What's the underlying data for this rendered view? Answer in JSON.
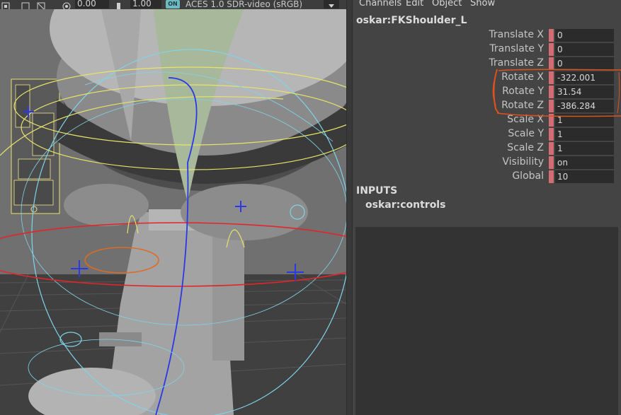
{
  "viewport_toolbar": {
    "icons": [
      "gate-mask-icon",
      "film-gate-icon",
      "resolution-gate-icon",
      "exposure-icon",
      "gamma-icon",
      "color-management-icon"
    ],
    "exposure_value": "0.00",
    "gamma_value": "1.00",
    "color_management_toggle": "ON",
    "color_space": "ACES 1.0 SDR-video (sRGB)"
  },
  "channel_box": {
    "menu": [
      "Channels",
      "Edit",
      "Object",
      "Show"
    ],
    "node_name": "oskar:FKShoulder_L",
    "attributes": [
      {
        "label": "Translate X",
        "value": "0"
      },
      {
        "label": "Translate Y",
        "value": "0"
      },
      {
        "label": "Translate Z",
        "value": "0"
      },
      {
        "label": "Rotate X",
        "value": "-322.001"
      },
      {
        "label": "Rotate Y",
        "value": "31.54"
      },
      {
        "label": "Rotate Z",
        "value": "-386.284"
      },
      {
        "label": "Scale X",
        "value": "1"
      },
      {
        "label": "Scale Y",
        "value": "1"
      },
      {
        "label": "Scale Z",
        "value": "1"
      },
      {
        "label": "Visibility",
        "value": "on"
      },
      {
        "label": "Global",
        "value": "10"
      }
    ],
    "inputs_header": "INPUTS",
    "inputs_node": "oskar:controls"
  },
  "colors": {
    "keyed_attribute": "#d36d74",
    "annotation_marker": "#e0521d",
    "viewport_background": "#6c6c6c",
    "panel_background": "#444444"
  }
}
